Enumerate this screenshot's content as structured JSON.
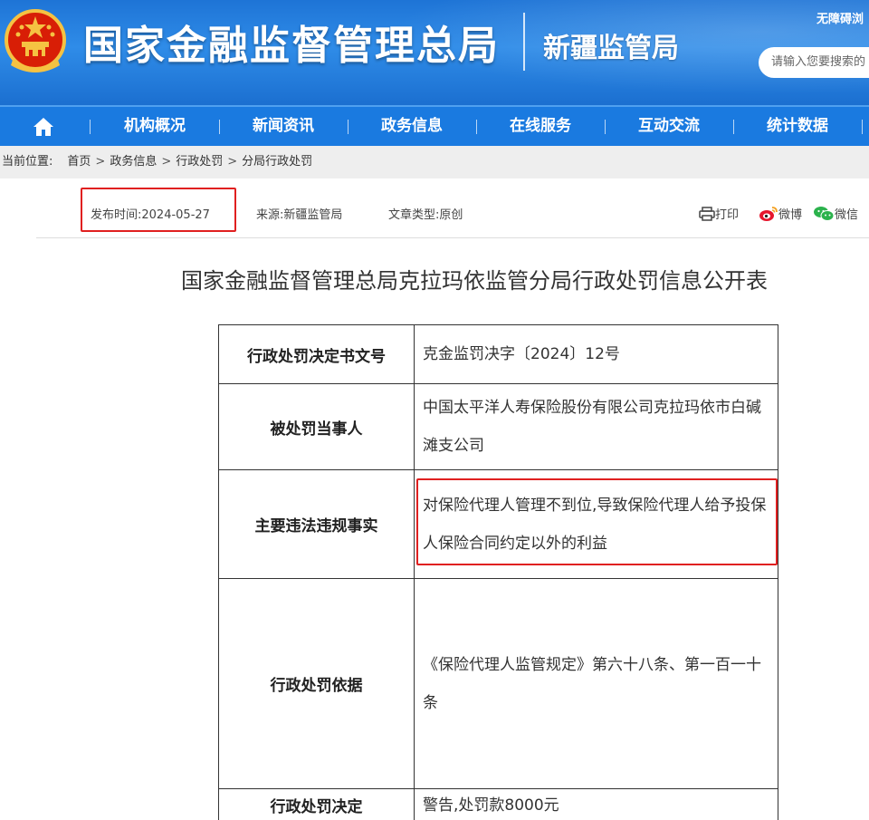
{
  "header": {
    "site_title": "国家金融监督管理总局",
    "sub_title": "新疆监管局",
    "accessibility_link": "无障碍浏",
    "search_placeholder": "请输入您要搜索的"
  },
  "nav": {
    "items": [
      {
        "label": "机构概况"
      },
      {
        "label": "新闻资讯"
      },
      {
        "label": "政务信息"
      },
      {
        "label": "在线服务"
      },
      {
        "label": "互动交流"
      },
      {
        "label": "统计数据"
      }
    ]
  },
  "breadcrumb": {
    "label": "当前位置:",
    "items": [
      "首页",
      "政务信息",
      "行政处罚",
      "分局行政处罚"
    ]
  },
  "meta": {
    "publish_time": "发布时间:2024-05-27",
    "source": "来源:新疆监管局",
    "article_type": "文章类型:原创",
    "print": "打印",
    "weibo": "微博",
    "wechat": "微信"
  },
  "article": {
    "title": "国家金融监督管理总局克拉玛依监管分局行政处罚信息公开表",
    "table": [
      {
        "label": "行政处罚决定书文号",
        "value": "克金监罚决字〔2024〕12号"
      },
      {
        "label": "被处罚当事人",
        "value": "中国太平洋人寿保险股份有限公司克拉玛依市白碱滩支公司"
      },
      {
        "label": "主要违法违规事实",
        "value": "对保险代理人管理不到位,导致保险代理人给予投保人保险合同约定以外的利益"
      },
      {
        "label": "行政处罚依据",
        "value": "《保险代理人监管规定》第六十八条、第一百一十条"
      },
      {
        "label": "行政处罚决定",
        "value": "警告,处罚款8000元"
      }
    ]
  },
  "colors": {
    "header_blue": "#1e74d6",
    "nav_blue": "#1a7ae0",
    "highlight_red": "#e02020"
  }
}
